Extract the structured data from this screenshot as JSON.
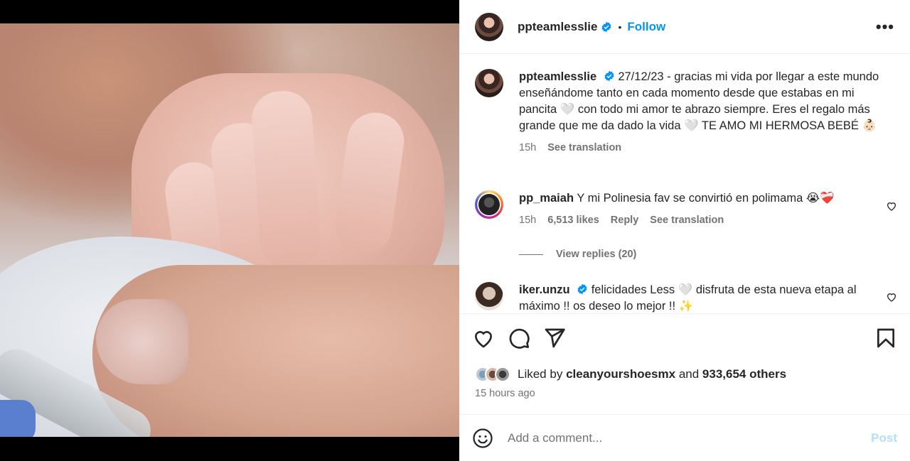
{
  "post": {
    "username": "ppteamlesslie",
    "follow_label": "Follow",
    "dot": "•",
    "more_label": "•••"
  },
  "caption": {
    "username": "ppteamlesslie",
    "text": "27/12/23 - gracias mi vida por llegar a este mundo enseñándome tanto en cada momento desde que estabas en mi pancita 🤍 con todo mi amor te abrazo siempre. Eres el regalo más grande que me da dado la vida 🤍 TE AMO MI HERMOSA BEBÉ 👶🏻",
    "time": "15h",
    "see_translation": "See translation"
  },
  "comments": [
    {
      "username": "pp_maiah",
      "text": "Y mi Polinesia fav se convirtió en polimama 😭❤️‍🩹",
      "time": "15h",
      "likes": "6,513 likes",
      "reply": "Reply",
      "see_translation": "See translation",
      "view_replies": "View replies (20)"
    },
    {
      "username": "iker.unzu",
      "text": "felicidades Less 🤍 disfruta de esta nueva etapa al máximo !! os deseo lo mejor !! ✨"
    }
  ],
  "likes": {
    "prefix": "Liked by",
    "user": "cleanyourshoesmx",
    "middle": "and",
    "others": "933,654 others"
  },
  "time_ago": "15 hours ago",
  "add_comment": {
    "placeholder": "Add a comment...",
    "post_label": "Post"
  },
  "colors": {
    "accent": "#0095f6",
    "verified": "#0095f6",
    "muted": "#737373",
    "post_disabled": "#b2dffc"
  },
  "icons": [
    "verified-badge-icon",
    "more-options-icon",
    "heart-icon",
    "comment-icon",
    "share-icon",
    "bookmark-icon",
    "smile-icon"
  ]
}
